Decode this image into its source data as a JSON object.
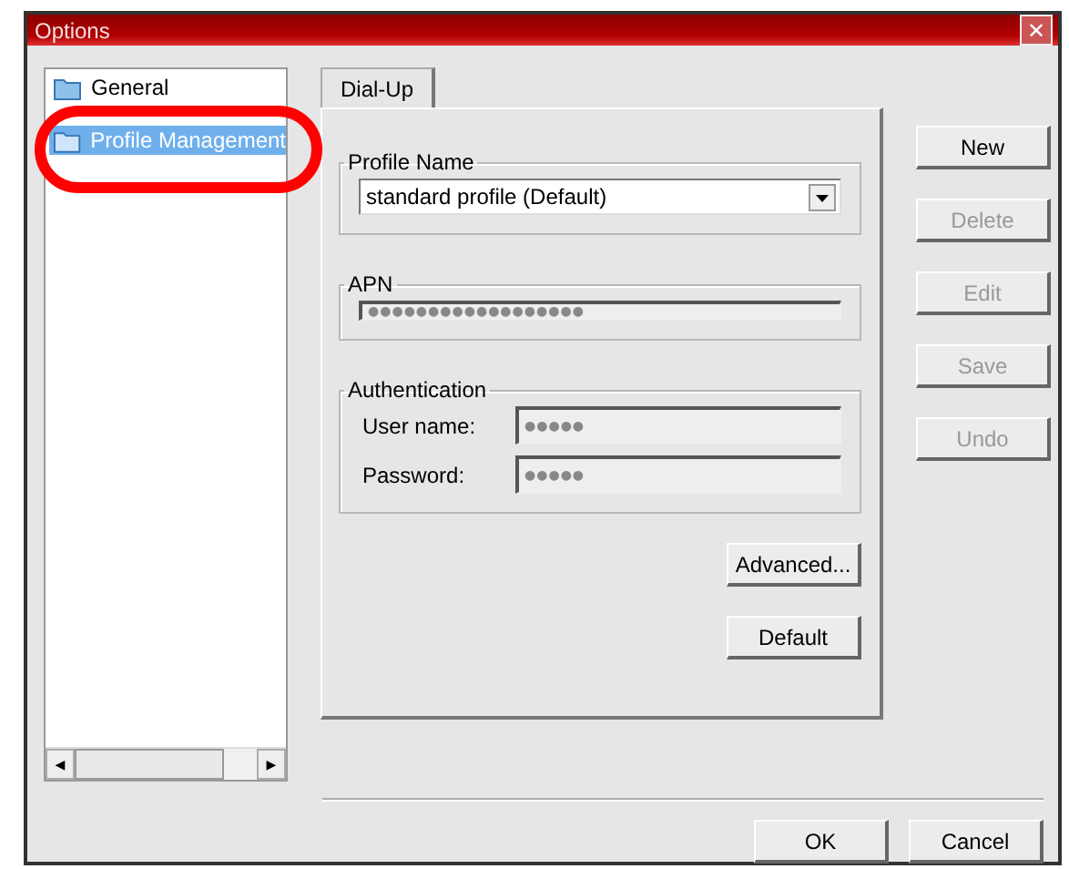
{
  "window": {
    "title": "Options",
    "close": "✕"
  },
  "tree": {
    "items": [
      {
        "label": "General",
        "selected": false
      },
      {
        "label": "Profile Management",
        "selected": true
      }
    ],
    "scroll_left": "◀",
    "scroll_right": "▶"
  },
  "tabs": [
    {
      "label": "Dial-Up",
      "selected": true
    }
  ],
  "profile_group": {
    "title": "Profile Name",
    "value": "standard profile (Default)"
  },
  "apn_group": {
    "title": "APN",
    "value": "●●●●●●●●●●●●●●●●●●",
    "disabled": true
  },
  "auth_group": {
    "title": "Authentication",
    "fields": [
      {
        "label": "User name:",
        "value": "●●●●●",
        "disabled": true
      },
      {
        "label": "Password:",
        "value": "●●●●●",
        "disabled": true
      }
    ]
  },
  "panel_buttons": [
    {
      "label": "Advanced...",
      "disabled": false
    },
    {
      "label": "Default",
      "disabled": false
    }
  ],
  "side_buttons": [
    {
      "label": "New",
      "disabled": false
    },
    {
      "label": "Delete",
      "disabled": true
    },
    {
      "label": "Edit",
      "disabled": true
    },
    {
      "label": "Save",
      "disabled": true
    },
    {
      "label": "Undo",
      "disabled": true
    }
  ],
  "footer_buttons": [
    {
      "label": "OK",
      "disabled": false
    },
    {
      "label": "Cancel",
      "disabled": false
    }
  ],
  "annotation": {
    "visible": true
  }
}
